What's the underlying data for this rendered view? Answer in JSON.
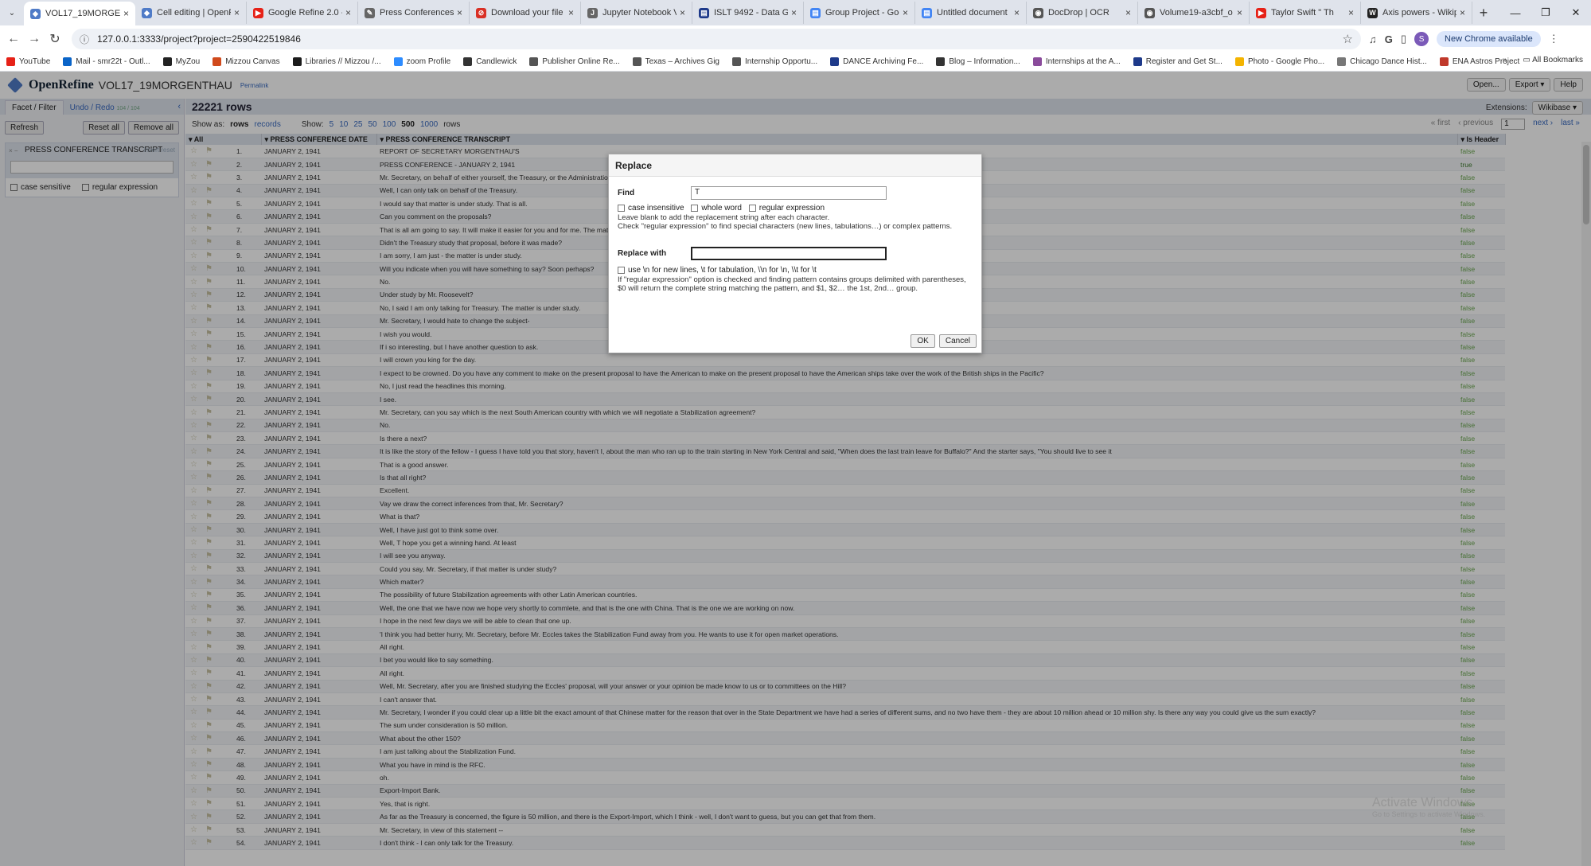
{
  "browser": {
    "tabs": [
      {
        "title": "VOL17_19MORGEN",
        "color": "#4f7bc7",
        "glyph": "◆",
        "active": true
      },
      {
        "title": "Cell editing | OpenR",
        "color": "#4f7bc7",
        "glyph": "◆"
      },
      {
        "title": "Google Refine 2.0 -",
        "color": "#e62117",
        "glyph": "▶"
      },
      {
        "title": "Press Conferences -",
        "color": "#666666",
        "glyph": "✎"
      },
      {
        "title": "Download your file",
        "color": "#d93025",
        "glyph": "⊘"
      },
      {
        "title": "Jupyter Notebook V",
        "color": "#666666",
        "glyph": "J"
      },
      {
        "title": "ISLT 9492 - Data Gr",
        "color": "#1e3a8a",
        "glyph": "▤"
      },
      {
        "title": "Group Project - Goo",
        "color": "#4285f4",
        "glyph": "▤"
      },
      {
        "title": "Untitled document",
        "color": "#4285f4",
        "glyph": "▤"
      },
      {
        "title": "DocDrop | OCR",
        "color": "#555555",
        "glyph": "◉"
      },
      {
        "title": "Volume19-a3cbf_o",
        "color": "#555555",
        "glyph": "◉"
      },
      {
        "title": "Taylor Swift \" Th",
        "color": "#e62117",
        "glyph": "▶"
      },
      {
        "title": "Axis powers - Wikip",
        "color": "#222222",
        "glyph": "W"
      }
    ],
    "url": "127.0.0.1:3333/project?project=2590422519846",
    "update_label": "New Chrome available",
    "profile_initial": "S",
    "bookmarks": [
      {
        "label": "YouTube",
        "color": "#e62117"
      },
      {
        "label": "Mail - smr22t - Outl...",
        "color": "#0a64c8"
      },
      {
        "label": "MyZou",
        "color": "#222222"
      },
      {
        "label": "Mizzou Canvas",
        "color": "#d04a1c"
      },
      {
        "label": "Libraries // Mizzou /...",
        "color": "#1b1b1b"
      },
      {
        "label": "zoom Profile",
        "color": "#2d8cff"
      },
      {
        "label": "Candlewick",
        "color": "#333333"
      },
      {
        "label": "Publisher Online Re...",
        "color": "#555555"
      },
      {
        "label": "Texas – Archives Gig",
        "color": "#555555"
      },
      {
        "label": "Internship Opportu...",
        "color": "#555555"
      },
      {
        "label": "DANCE Archiving Fe...",
        "color": "#1e3a8a"
      },
      {
        "label": "Blog – Information...",
        "color": "#333333"
      },
      {
        "label": "Internships at the A...",
        "color": "#8a4b9b"
      },
      {
        "label": "Register and Get St...",
        "color": "#1e3a8a"
      },
      {
        "label": "Photo - Google Pho...",
        "color": "#f4b400"
      },
      {
        "label": "Chicago Dance Hist...",
        "color": "#777777"
      },
      {
        "label": "ENA Astros Project",
        "color": "#c0392b"
      }
    ],
    "all_bookmarks": "All Bookmarks"
  },
  "app": {
    "brand": "OpenRefine",
    "project_name": "VOL17_19MORGENTHAU",
    "permalink": "Permalink",
    "buttons": [
      "Open...",
      "Export ▾",
      "Help"
    ],
    "tab_facet": "Facet / Filter",
    "tab_undo": "Undo / Redo",
    "undo_count": "104 / 104",
    "refresh": "Refresh",
    "reset_all": "Reset all",
    "remove_all": "Remove all",
    "facet_title": "PRESS CONFERENCE TRANSCRIPT",
    "facet_actions": "invert reset",
    "case_sensitive": "case sensitive",
    "regex": "regular expression",
    "rows_count": "22221 rows",
    "extensions": "Extensions:",
    "wikibase": "Wikibase ▾",
    "show_as": "Show as:",
    "show_rows": "rows",
    "show_records": "records",
    "show_label": "Show:",
    "page_sizes": [
      "5",
      "10",
      "25",
      "50",
      "100",
      "500",
      "1000"
    ],
    "rows_word": "rows",
    "pager": {
      "first": "« first",
      "prev": "‹ previous",
      "page": "1",
      "next": "next ›",
      "last": "last »"
    },
    "col_all": "All",
    "col_date": "PRESS CONFERENCE DATE",
    "col_transcript": "PRESS CONFERENCE TRANSCRIPT",
    "col_header": "Is Header",
    "watermark_title": "Activate Windows",
    "watermark_sub": "Go to Settings to activate Windows."
  },
  "rows": [
    {
      "n": "1.",
      "d": "JANUARY 2, 1941",
      "t": "REPORT OF SECRETARY MORGENTHAU'S",
      "h": "false"
    },
    {
      "n": "2.",
      "d": "JANUARY 2, 1941",
      "t": "PRESS CONFERENCE - JANUARY 2, 1941",
      "h": "true"
    },
    {
      "n": "3.",
      "d": "JANUARY 2, 1941",
      "t": "Mr. Secretary, on behalf of either yourself, the Treasury, or the Administration, will you",
      "h": "false"
    },
    {
      "n": "4.",
      "d": "JANUARY 2, 1941",
      "t": "Well, I can only talk on behalf of the Treasury.",
      "h": "false"
    },
    {
      "n": "5.",
      "d": "JANUARY 2, 1941",
      "t": "I would say that matter is under study. That is all.",
      "h": "false"
    },
    {
      "n": "6.",
      "d": "JANUARY 2, 1941",
      "t": "Can you comment on the proposals?",
      "h": "false"
    },
    {
      "n": "7.",
      "d": "JANUARY 2, 1941",
      "t": "That is all am going to say. It will make it easier for you and for me. The matter is u",
      "h": "false"
    },
    {
      "n": "8.",
      "d": "JANUARY 2, 1941",
      "t": "Didn't the Treasury study that proposal, before it was made?",
      "h": "false"
    },
    {
      "n": "9.",
      "d": "JANUARY 2, 1941",
      "t": "I am sorry, I am just - the matter is under study.",
      "h": "false"
    },
    {
      "n": "10.",
      "d": "JANUARY 2, 1941",
      "t": "Will you indicate when you will have something to say? Soon perhaps?",
      "h": "false"
    },
    {
      "n": "11.",
      "d": "JANUARY 2, 1941",
      "t": "No.",
      "h": "false"
    },
    {
      "n": "12.",
      "d": "JANUARY 2, 1941",
      "t": "Under study by Mr. Roosevelt?",
      "h": "false"
    },
    {
      "n": "13.",
      "d": "JANUARY 2, 1941",
      "t": "No, I said I am only talking for Treasury. The matter is under study.",
      "h": "false"
    },
    {
      "n": "14.",
      "d": "JANUARY 2, 1941",
      "t": "Mr. Secretary, I would hate to change the subject-",
      "h": "false"
    },
    {
      "n": "15.",
      "d": "JANUARY 2, 1941",
      "t": "I wish you would.",
      "h": "false"
    },
    {
      "n": "16.",
      "d": "JANUARY 2, 1941",
      "t": "If i so interesting, but I have another question to ask.",
      "h": "false"
    },
    {
      "n": "17.",
      "d": "JANUARY 2, 1941",
      "t": "I will crown you king for the day.",
      "h": "false"
    },
    {
      "n": "18.",
      "d": "JANUARY 2, 1941",
      "t": "I expect to be crowned. Do you have any comment to make on the present proposal to have the American to make on the present proposal to have the American ships take over the work of the British ships in the Pacific?",
      "h": "false"
    },
    {
      "n": "19.",
      "d": "JANUARY 2, 1941",
      "t": "No, I just read the headlines this morning.",
      "h": "false"
    },
    {
      "n": "20.",
      "d": "JANUARY 2, 1941",
      "t": "I see.",
      "h": "false"
    },
    {
      "n": "21.",
      "d": "JANUARY 2, 1941",
      "t": "Mr. Secretary, can you say which is the next South American country with which we will negotiate a Stabilization agreement?",
      "h": "false"
    },
    {
      "n": "22.",
      "d": "JANUARY 2, 1941",
      "t": "No.",
      "h": "false"
    },
    {
      "n": "23.",
      "d": "JANUARY 2, 1941",
      "t": "Is there a next?",
      "h": "false"
    },
    {
      "n": "24.",
      "d": "JANUARY 2, 1941",
      "t": "It is like the story of the fellow - I guess I have told you that story, haven't I, about the man who ran up to the train starting in New York Central and said, \"When does the last train leave for Buffalo?\" And the starter says, \"You should live to see it",
      "h": "false"
    },
    {
      "n": "25.",
      "d": "JANUARY 2, 1941",
      "t": "That is a good answer.",
      "h": "false"
    },
    {
      "n": "26.",
      "d": "JANUARY 2, 1941",
      "t": "Is that all right?",
      "h": "false"
    },
    {
      "n": "27.",
      "d": "JANUARY 2, 1941",
      "t": "Excellent.",
      "h": "false"
    },
    {
      "n": "28.",
      "d": "JANUARY 2, 1941",
      "t": "Vay we draw the correct inferences from that, Mr. Secretary?",
      "h": "false"
    },
    {
      "n": "29.",
      "d": "JANUARY 2, 1941",
      "t": "What is that?",
      "h": "false"
    },
    {
      "n": "30.",
      "d": "JANUARY 2, 1941",
      "t": "Well, I have just got to think some over.",
      "h": "false"
    },
    {
      "n": "31.",
      "d": "JANUARY 2, 1941",
      "t": "Well, T hope you get a winning hand. At least",
      "h": "false"
    },
    {
      "n": "32.",
      "d": "JANUARY 2, 1941",
      "t": "I will see you anyway.",
      "h": "false"
    },
    {
      "n": "33.",
      "d": "JANUARY 2, 1941",
      "t": "Could you say, Mr. Secretary, if that matter is under study?",
      "h": "false"
    },
    {
      "n": "34.",
      "d": "JANUARY 2, 1941",
      "t": "Which matter?",
      "h": "false"
    },
    {
      "n": "35.",
      "d": "JANUARY 2, 1941",
      "t": "The possibility of future Stabilization agreements with other Latin American countries.",
      "h": "false"
    },
    {
      "n": "36.",
      "d": "JANUARY 2, 1941",
      "t": "Well, the one that we have now we hope very shortly to commlete, and that is the one with China. That is the one we are working on now.",
      "h": "false"
    },
    {
      "n": "37.",
      "d": "JANUARY 2, 1941",
      "t": "I hope in the next few days we will be able to clean that one up.",
      "h": "false"
    },
    {
      "n": "38.",
      "d": "JANUARY 2, 1941",
      "t": "'I think you had better hurry, Mr. Secretary, before Mr. Eccles takes the Stabilization Fund away from you. He wants to use it for open market operations.",
      "h": "false"
    },
    {
      "n": "39.",
      "d": "JANUARY 2, 1941",
      "t": "All right.",
      "h": "false"
    },
    {
      "n": "40.",
      "d": "JANUARY 2, 1941",
      "t": "I bet you would like to say something.",
      "h": "false"
    },
    {
      "n": "41.",
      "d": "JANUARY 2, 1941",
      "t": "All right.",
      "h": "false"
    },
    {
      "n": "42.",
      "d": "JANUARY 2, 1941",
      "t": "Well, Mr. Secretary, after you are finished studying the Eccles' proposal, will your answer or your opinion be made know to us or to committees on the Hill?",
      "h": "false"
    },
    {
      "n": "43.",
      "d": "JANUARY 2, 1941",
      "t": "I can't answer that.",
      "h": "false"
    },
    {
      "n": "44.",
      "d": "JANUARY 2, 1941",
      "t": "Mr. Secretary, I wonder if you could clear up a little bit the exact amount of that Chinese matter for the reason that over in the State Department we have had a series of different sums, and no two have them - they are about 10 million ahead or 10 million shy. Is there any way you could give us the sum exactly?",
      "h": "false"
    },
    {
      "n": "45.",
      "d": "JANUARY 2, 1941",
      "t": "The sum under consideration is 50 million.",
      "h": "false"
    },
    {
      "n": "46.",
      "d": "JANUARY 2, 1941",
      "t": "What about the other 150?",
      "h": "false"
    },
    {
      "n": "47.",
      "d": "JANUARY 2, 1941",
      "t": "I am just talking about the Stabilization Fund.",
      "h": "false"
    },
    {
      "n": "48.",
      "d": "JANUARY 2, 1941",
      "t": "What you have in mind is the RFC.",
      "h": "false"
    },
    {
      "n": "49.",
      "d": "JANUARY 2, 1941",
      "t": "oh.",
      "h": "false"
    },
    {
      "n": "50.",
      "d": "JANUARY 2, 1941",
      "t": "Export-Import Bank.",
      "h": "false"
    },
    {
      "n": "51.",
      "d": "JANUARY 2, 1941",
      "t": "Yes, that is right.",
      "h": "false"
    },
    {
      "n": "52.",
      "d": "JANUARY 2, 1941",
      "t": "As far as the Treasury is concerned, the figure is 50 million, and there is the Export-Import, which I think - well, I don't want to guess, but you can get that from them.",
      "h": "false"
    },
    {
      "n": "53.",
      "d": "JANUARY 2, 1941",
      "t": "Mr. Secretary, in view of this statement --",
      "h": "false"
    },
    {
      "n": "54.",
      "d": "JANUARY 2, 1941",
      "t": "I don't think - I can only talk for the Treasury.",
      "h": "false"
    }
  ],
  "dialog": {
    "title": "Replace",
    "find_label": "Find",
    "find_value": "T",
    "opt_case": "case insensitive",
    "opt_whole": "whole word",
    "opt_regex": "regular expression",
    "find_hint1": "Leave blank to add the replacement string after each character.",
    "find_hint2": "Check \"regular expression\" to find special characters (new lines, tabulations…) or complex patterns.",
    "replace_label": "Replace with",
    "replace_value": "",
    "opt_escape": "use \\n for new lines, \\t for tabulation, \\\\n for \\n, \\\\t for \\t",
    "replace_hint": "If \"regular expression\" option is checked and finding pattern contains groups delimited with parentheses, $0 will return the complete string matching the pattern, and $1, $2… the 1st, 2nd… group.",
    "ok": "OK",
    "cancel": "Cancel"
  }
}
